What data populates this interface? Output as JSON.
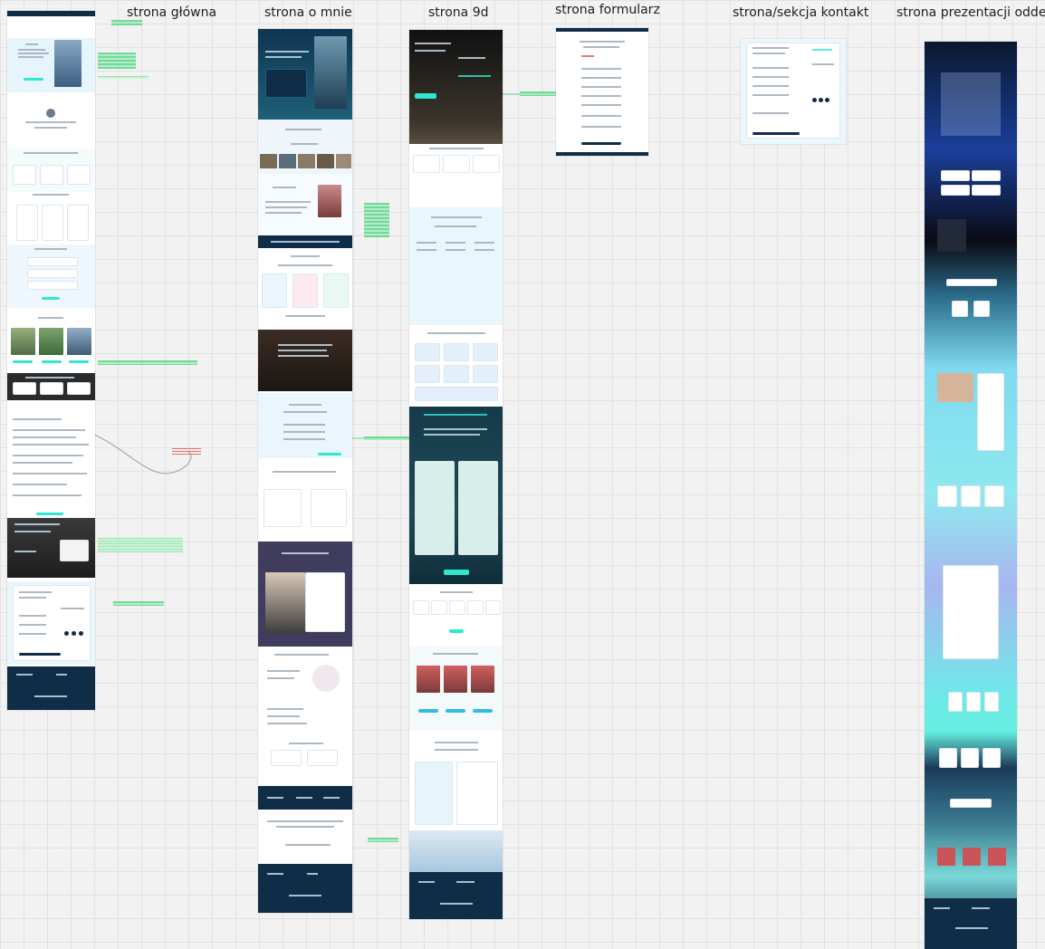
{
  "canvas": {
    "background": "#f2f2f2",
    "grid_color": "#e2e2e2"
  },
  "columns": [
    {
      "label": "strona główna"
    },
    {
      "label": "strona o mnie"
    },
    {
      "label": "strona 9d"
    },
    {
      "label": "strona formularz"
    },
    {
      "label": "strona/sekcja kontakt"
    },
    {
      "label": "strona prezentacji oddech"
    }
  ],
  "colors": {
    "navy": "#0f2d47",
    "teal": "#2ee8d0",
    "light_blue": "#e6f5fc",
    "dark": "#2b2b2b",
    "purple": "#403c5e",
    "note_green": "#5fd48a"
  }
}
